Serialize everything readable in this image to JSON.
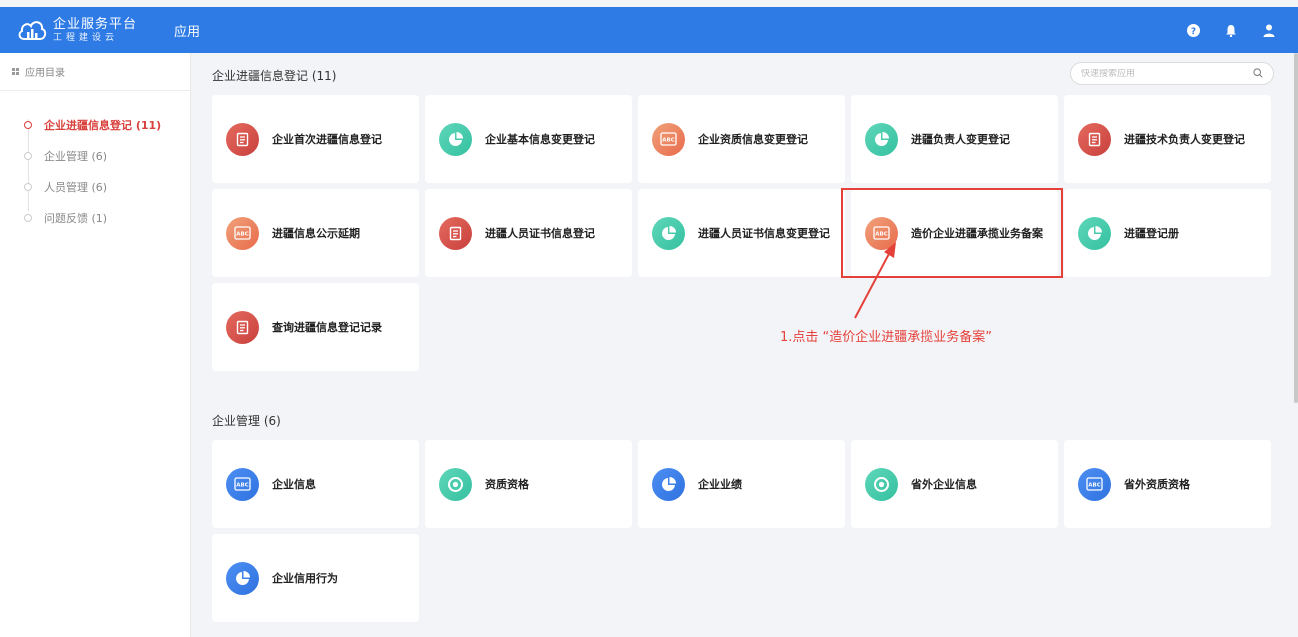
{
  "header": {
    "logo_title": "企业服务平台",
    "logo_subtitle": "工程建设云",
    "app_label": "应用",
    "bg_color": "#2e7be6"
  },
  "sidebar": {
    "title": "应用目录",
    "items": [
      {
        "label": "企业进疆信息登记 (11)",
        "active": true
      },
      {
        "label": "企业管理 (6)",
        "active": false
      },
      {
        "label": "人员管理 (6)",
        "active": false
      },
      {
        "label": "问题反馈 (1)",
        "active": false
      }
    ]
  },
  "search": {
    "placeholder": "快速搜索应用"
  },
  "sections": [
    {
      "title": "企业进疆信息登记 (11)",
      "cards": [
        {
          "label": "企业首次进疆信息登记",
          "icon": "doc-icon",
          "color": "red"
        },
        {
          "label": "企业基本信息变更登记",
          "icon": "pie-chart-icon",
          "color": "green"
        },
        {
          "label": "企业资质信息变更登记",
          "icon": "abc-icon",
          "color": "orange"
        },
        {
          "label": "进疆负责人变更登记",
          "icon": "pie-chart-icon",
          "color": "green"
        },
        {
          "label": "进疆技术负责人变更登记",
          "icon": "doc-icon",
          "color": "red"
        },
        {
          "label": "进疆信息公示延期",
          "icon": "abc-icon",
          "color": "orange"
        },
        {
          "label": "进疆人员证书信息登记",
          "icon": "doc-icon",
          "color": "red"
        },
        {
          "label": "进疆人员证书信息变更登记",
          "icon": "pie-chart-icon",
          "color": "green"
        },
        {
          "label": "造价企业进疆承揽业务备案",
          "icon": "abc-icon",
          "color": "orange"
        },
        {
          "label": "进疆登记册",
          "icon": "pie-chart-icon",
          "color": "green"
        },
        {
          "label": "查询进疆信息登记记录",
          "icon": "doc-icon",
          "color": "red"
        }
      ]
    },
    {
      "title": "企业管理 (6)",
      "cards": [
        {
          "label": "企业信息",
          "icon": "abc-icon",
          "color": "blue"
        },
        {
          "label": "资质资格",
          "icon": "target-icon",
          "color": "green"
        },
        {
          "label": "企业业绩",
          "icon": "pie-chart-icon",
          "color": "blue"
        },
        {
          "label": "省外企业信息",
          "icon": "target-icon",
          "color": "green"
        },
        {
          "label": "省外资质资格",
          "icon": "abc-icon",
          "color": "blue"
        },
        {
          "label": "企业信用行为",
          "icon": "pie-chart-icon",
          "color": "blue"
        }
      ]
    }
  ],
  "annotation": {
    "text": "1.点击 “造价企业进疆承揽业务备案”",
    "color": "#e5413b"
  }
}
